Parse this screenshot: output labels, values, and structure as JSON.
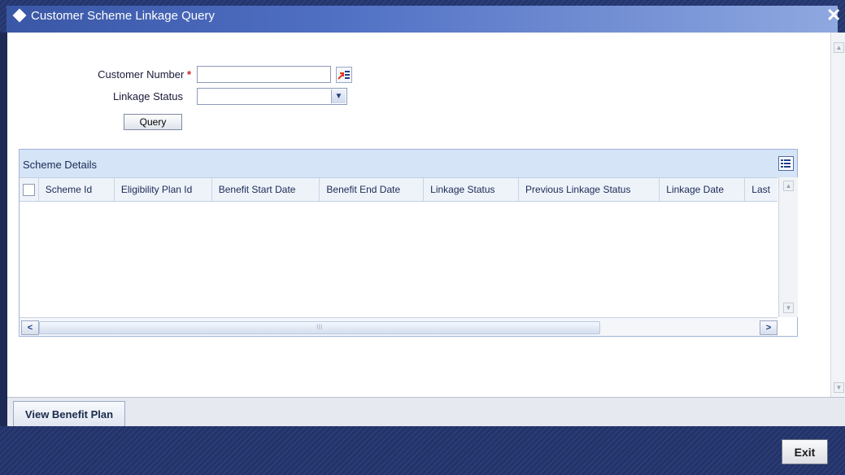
{
  "window": {
    "title": "Customer Scheme Linkage Query"
  },
  "form": {
    "customer_number_label": "Customer Number",
    "required_mark": "*",
    "customer_number_value": "",
    "linkage_status_label": "Linkage Status",
    "linkage_status_value": "",
    "query_label": "Query"
  },
  "grid": {
    "title": "Scheme Details",
    "columns": [
      "Scheme Id",
      "Eligibility Plan Id",
      "Benefit Start Date",
      "Benefit End Date",
      "Linkage Status",
      "Previous Linkage Status",
      "Linkage Date",
      "Last"
    ],
    "rows": [],
    "scroll_center_mark": "III"
  },
  "tabs": {
    "view_benefit_plan": "View Benefit Plan"
  },
  "footer": {
    "exit_label": "Exit"
  },
  "icons": {
    "close": "close-icon",
    "lov": "list-of-values-icon",
    "dropdown": "chevron-down-icon",
    "grid_menu": "grid-options-icon"
  }
}
